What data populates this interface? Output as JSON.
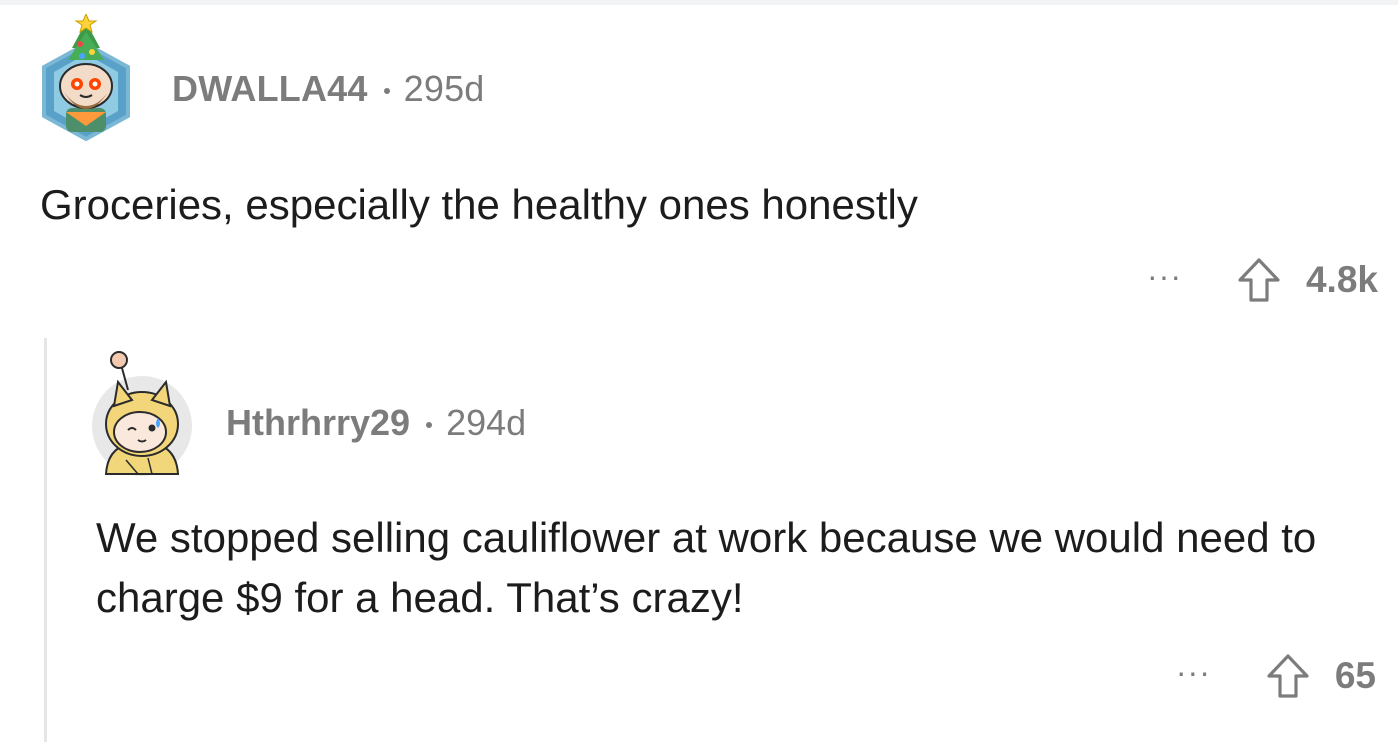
{
  "comments": [
    {
      "username": "DWALLA44",
      "age": "295d",
      "body": "Groceries, especially the healthy ones honestly",
      "more": "···",
      "score": "4.8k",
      "avatar_icon": "christmas-tree-snoo-avatar-icon"
    }
  ],
  "replies": [
    {
      "username": "Hthrhrry29",
      "age": "294d",
      "body": "We stopped selling cauliflower at work because we would need to charge $9 for a head. That’s crazy!",
      "more": "···",
      "score": "65",
      "avatar_icon": "doge-costume-snoo-avatar-icon"
    }
  ],
  "colors": {
    "meta_text": "#7c7c7c",
    "body_text": "#1c1c1c",
    "thread_line": "#e6e6e6",
    "background": "#ffffff"
  }
}
